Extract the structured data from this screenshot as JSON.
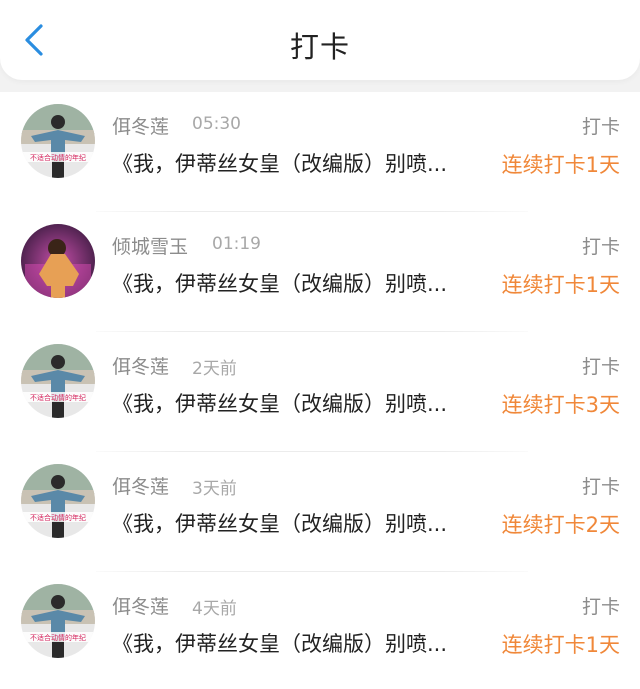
{
  "header": {
    "title": "打卡"
  },
  "colors": {
    "accent_back": "#2a8de0",
    "streak": "#f0883a"
  },
  "items": [
    {
      "user": "佴冬莲",
      "time": "05:30",
      "action": "打卡",
      "content": "《我，伊蒂丝女皇（改编版）别喷...",
      "streak": "连续打卡1天",
      "avatar_caption": "不适合动情的年纪"
    },
    {
      "user": "倾城雪玉",
      "time": "01:19",
      "action": "打卡",
      "content": "《我，伊蒂丝女皇（改编版）别喷...",
      "streak": "连续打卡1天",
      "avatar_caption": ""
    },
    {
      "user": "佴冬莲",
      "time": "2天前",
      "action": "打卡",
      "content": "《我，伊蒂丝女皇（改编版）别喷...",
      "streak": "连续打卡3天",
      "avatar_caption": "不适合动情的年纪"
    },
    {
      "user": "佴冬莲",
      "time": "3天前",
      "action": "打卡",
      "content": "《我，伊蒂丝女皇（改编版）别喷...",
      "streak": "连续打卡2天",
      "avatar_caption": "不适合动情的年纪"
    },
    {
      "user": "佴冬莲",
      "time": "4天前",
      "action": "打卡",
      "content": "《我，伊蒂丝女皇（改编版）别喷...",
      "streak": "连续打卡1天",
      "avatar_caption": "不适合动情的年纪"
    }
  ]
}
